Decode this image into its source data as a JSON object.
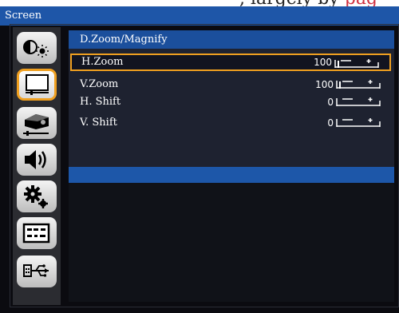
{
  "crop_fragment": {
    "part1": ", largely by",
    "part2": "pag"
  },
  "window": {
    "title": "Screen"
  },
  "sidebar": {
    "items": [
      {
        "name": "picture",
        "icon": "brightness-settings-icon",
        "selected": false
      },
      {
        "name": "screen",
        "icon": "screen-icon",
        "selected": true
      },
      {
        "name": "setting",
        "icon": "projector-icon",
        "selected": false
      },
      {
        "name": "volume",
        "icon": "speaker-icon",
        "selected": false
      },
      {
        "name": "options",
        "icon": "gears-icon",
        "selected": false
      },
      {
        "name": "information",
        "icon": "info-panel-icon",
        "selected": false
      },
      {
        "name": "usb",
        "icon": "usb-icon",
        "selected": false
      }
    ]
  },
  "panel": {
    "heading": "D.Zoom/Magnify",
    "rows": [
      {
        "label": "H.Zoom",
        "value": "100",
        "level": 1.0,
        "selected": true
      },
      {
        "label": "V.Zoom",
        "value": "100",
        "level": 1.0,
        "selected": false
      },
      {
        "label": "H. Shift",
        "value": "0",
        "level": 0.0,
        "selected": false
      },
      {
        "label": "V. Shift",
        "value": "0",
        "level": 0.0,
        "selected": false
      }
    ]
  },
  "colors": {
    "title_bar": "#1e56a8",
    "selection": "#f0a020",
    "panel_bg": "#1e2230"
  }
}
